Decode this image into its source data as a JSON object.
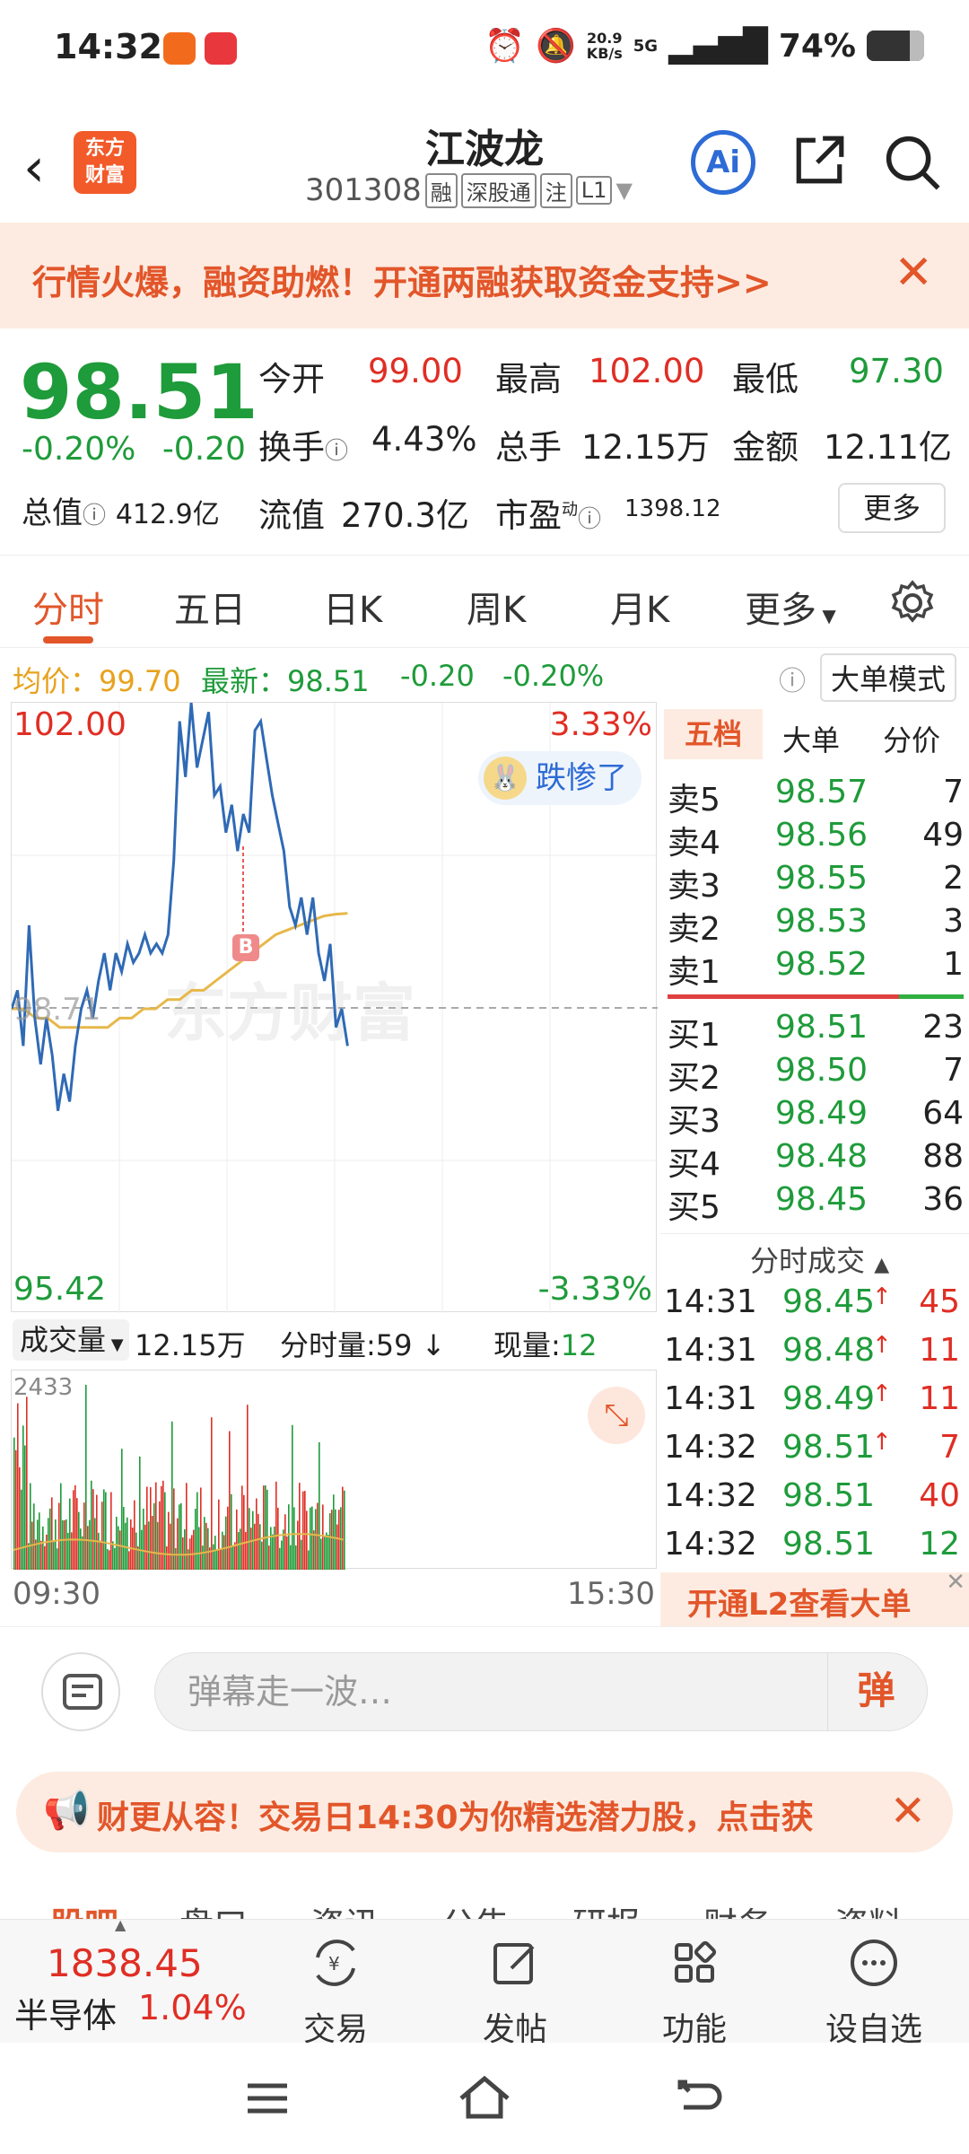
{
  "status_bar": {
    "time": "14:32",
    "net_speed": "20.9",
    "net_unit": "KB/s",
    "network": "5G",
    "battery": "74%",
    "battery_level": 0.74
  },
  "header": {
    "logo_line1": "东方",
    "logo_line2": "财富",
    "stock_name": "江波龙",
    "stock_code": "301308",
    "tags": [
      "融",
      "深股通",
      "注",
      "L1"
    ],
    "ai_label": "Ai"
  },
  "banner": {
    "text": "行情火爆，融资助燃！开通两融获取资金支持>>"
  },
  "quote": {
    "price": "98.51",
    "change_pct": "-0.20%",
    "change": "-0.20",
    "total_value_label": "总值",
    "total_value": "412.9亿",
    "open_label": "今开",
    "open": "99.00",
    "high_label": "最高",
    "high": "102.00",
    "low_label": "最低",
    "low": "97.30",
    "turnover_label": "换手",
    "turnover": "4.43%",
    "volume_label": "总手",
    "volume": "12.15万",
    "amount_label": "金额",
    "amount": "12.11亿",
    "float_value_label": "流值",
    "float_value": "270.3亿",
    "pe_label": "市盈",
    "pe_sup": "动",
    "pe": "1398.12",
    "more_label": "更多"
  },
  "tabs": [
    "分时",
    "五日",
    "日K",
    "周K",
    "月K",
    "更多"
  ],
  "avg_bar": {
    "avg_label": "均价：",
    "avg": "99.70",
    "latest_label": "最新：",
    "latest": "98.51",
    "chg": "-0.20",
    "chg_pct": "-0.20%",
    "mode_label": "大单模式"
  },
  "chart": {
    "y_top": "102.00",
    "y_bottom": "95.42",
    "pct_top": "3.33%",
    "pct_bottom": "-3.33%",
    "prev_close": "98.71",
    "badge": "跌惨了",
    "marker": "B",
    "watermark": "东方财富",
    "vol_label": "成交量",
    "vol_total": "12.15万",
    "vol_interval": "分时量:59",
    "vol_now_label": "现量:",
    "vol_now": "12",
    "vol_max": "2433",
    "time_start": "09:30",
    "time_end": "15:30"
  },
  "chart_data": {
    "type": "line",
    "x_range": [
      "09:30",
      "15:30"
    ],
    "ylim": [
      95.42,
      102.0
    ],
    "prev_close": 98.71,
    "series": [
      {
        "values": [
          98.7,
          98.9,
          98.3,
          99.6,
          98.6,
          98.1,
          98.6,
          98.2,
          97.6,
          98.0,
          97.7,
          98.3,
          98.7,
          98.9,
          98.6,
          99.0,
          99.3,
          98.9,
          99.3,
          99.1,
          99.4,
          99.2,
          99.3,
          99.5,
          99.3,
          99.4,
          99.3,
          99.5,
          100.3,
          101.8,
          101.2,
          102.0,
          101.3,
          101.6,
          101.9,
          101.0,
          101.1,
          100.6,
          100.9,
          100.4,
          100.8,
          100.6,
          101.7,
          101.8,
          101.4,
          101.0,
          100.7,
          100.4,
          99.8,
          99.6,
          99.9,
          99.5,
          99.9,
          99.3,
          99.0,
          99.4,
          98.5,
          98.7,
          98.3
        ]
      },
      {
        "values": [
          98.7,
          98.7,
          98.6,
          98.6,
          98.5,
          98.5,
          98.5,
          98.5,
          98.5,
          98.6,
          98.6,
          98.7,
          98.7,
          98.8,
          98.8,
          98.9,
          98.9,
          99.0,
          99.1,
          99.2,
          99.3,
          99.4,
          99.5,
          99.55,
          99.6,
          99.65,
          99.7,
          99.72,
          99.73
        ]
      }
    ]
  },
  "order_book": {
    "tabs": [
      "五档",
      "大单",
      "分价"
    ],
    "asks": [
      {
        "label": "卖5",
        "price": "98.57",
        "vol": "7"
      },
      {
        "label": "卖4",
        "price": "98.56",
        "vol": "49"
      },
      {
        "label": "卖3",
        "price": "98.55",
        "vol": "2"
      },
      {
        "label": "卖2",
        "price": "98.53",
        "vol": "3"
      },
      {
        "label": "卖1",
        "price": "98.52",
        "vol": "1"
      }
    ],
    "bids": [
      {
        "label": "买1",
        "price": "98.51",
        "vol": "23"
      },
      {
        "label": "买2",
        "price": "98.50",
        "vol": "7"
      },
      {
        "label": "买3",
        "price": "98.49",
        "vol": "64"
      },
      {
        "label": "买4",
        "price": "98.48",
        "vol": "88"
      },
      {
        "label": "买5",
        "price": "98.45",
        "vol": "36"
      }
    ],
    "trades_title": "分时成交",
    "trades": [
      {
        "time": "14:31",
        "price": "98.45",
        "arrow": "↑",
        "vol": "45"
      },
      {
        "time": "14:31",
        "price": "98.48",
        "arrow": "↑",
        "vol": "11"
      },
      {
        "time": "14:31",
        "price": "98.49",
        "arrow": "↑",
        "vol": "11"
      },
      {
        "time": "14:32",
        "price": "98.51",
        "arrow": "↑",
        "vol": "7"
      },
      {
        "time": "14:32",
        "price": "98.51",
        "arrow": "",
        "vol": "40"
      },
      {
        "time": "14:32",
        "price": "98.51",
        "arrow": "",
        "vol": "12"
      }
    ],
    "l2_text": "开通L2查看大单"
  },
  "comment": {
    "placeholder": "弹幕走一波…",
    "danmu_btn": "弹"
  },
  "promo": {
    "text": "财更从容！交易日14:30为你精选潜力股，点击获"
  },
  "subtabs": [
    "股吧",
    "盘口",
    "资讯",
    "公告",
    "研报",
    "财务",
    "资料"
  ],
  "bottom_bar": {
    "index_value": "1838.45",
    "index_name": "半导体",
    "index_pct": "1.04%",
    "items": [
      "交易",
      "发帖",
      "功能",
      "设自选"
    ]
  },
  "colors": {
    "accent": "#e2562a",
    "up": "#e02e24",
    "down": "#1e9b3a",
    "price_line": "#2f6ab5",
    "avg_line": "#e6b84a"
  }
}
